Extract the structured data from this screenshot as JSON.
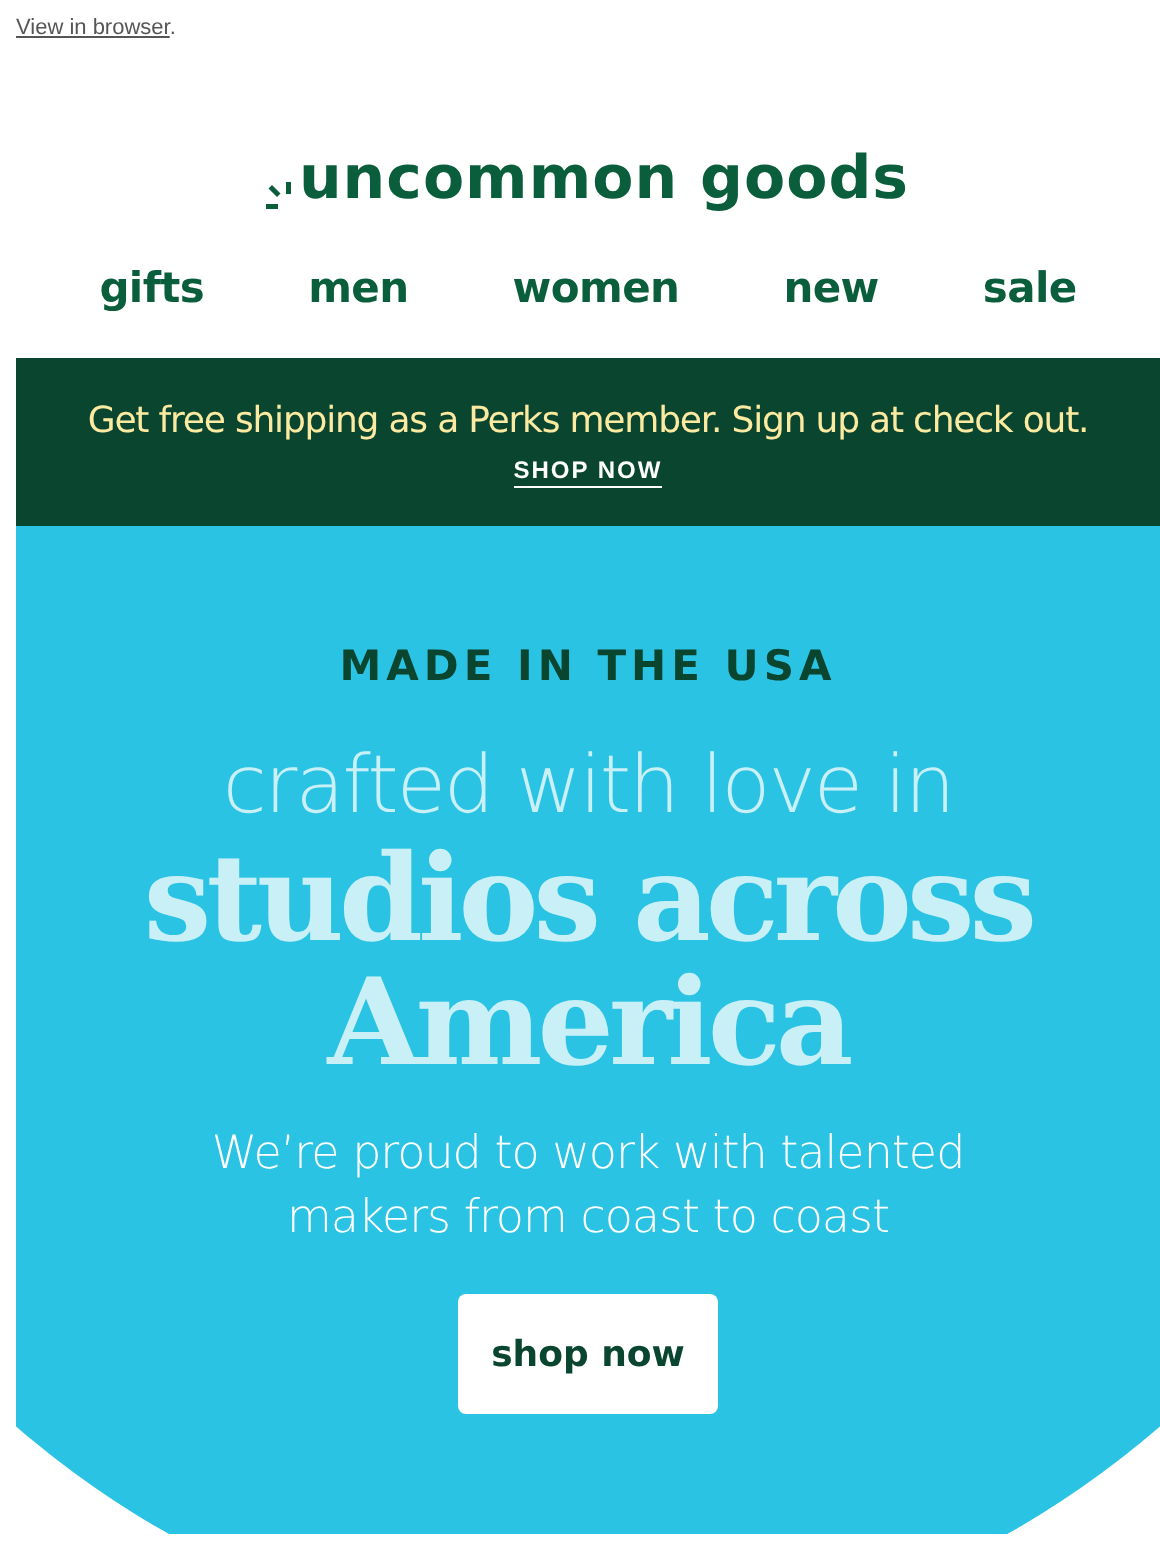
{
  "preheader": {
    "link": "View in browser",
    "suffix": "."
  },
  "logo": {
    "text": "uncommon goods"
  },
  "nav": [
    {
      "label": "gifts"
    },
    {
      "label": "men"
    },
    {
      "label": "women"
    },
    {
      "label": "new"
    },
    {
      "label": "sale"
    }
  ],
  "promo_banner": {
    "text": "Get free shipping as a Perks member. Sign up at check out.",
    "link": "SHOP NOW"
  },
  "hero": {
    "eyebrow": "MADE IN THE USA",
    "intro": "crafted with love in",
    "headline": [
      "studios across",
      "America"
    ],
    "subtitle": [
      "We’re proud to work with talented",
      "makers from coast to coast"
    ],
    "button": "shop now"
  }
}
